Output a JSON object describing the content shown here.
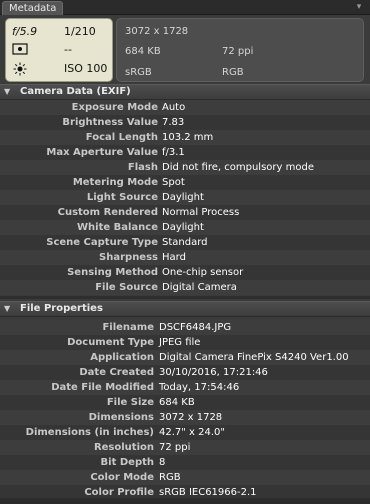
{
  "tab": {
    "label": "Metadata"
  },
  "summary": {
    "aperture": "f/5.9",
    "shutter": "1/210",
    "exposure_comp": "--",
    "iso": "ISO 100",
    "dimensions": "3072 x 1728",
    "size": "684 KB",
    "resolution": "72 ppi",
    "profile": "sRGB",
    "color_mode": "RGB"
  },
  "exif": {
    "title": "Camera Data (EXIF)",
    "rows": [
      {
        "label": "Exposure Mode",
        "value": "Auto"
      },
      {
        "label": "Brightness Value",
        "value": "7.83"
      },
      {
        "label": "Focal Length",
        "value": "103.2 mm"
      },
      {
        "label": "Max Aperture Value",
        "value": "f/3.1"
      },
      {
        "label": "Flash",
        "value": "Did not fire, compulsory mode"
      },
      {
        "label": "Metering Mode",
        "value": "Spot"
      },
      {
        "label": "Light Source",
        "value": "Daylight"
      },
      {
        "label": "Custom Rendered",
        "value": "Normal Process"
      },
      {
        "label": "White Balance",
        "value": "Daylight"
      },
      {
        "label": "Scene Capture Type",
        "value": "Standard"
      },
      {
        "label": "Sharpness",
        "value": "Hard"
      },
      {
        "label": "Sensing Method",
        "value": "One-chip sensor"
      },
      {
        "label": "File Source",
        "value": "Digital Camera"
      }
    ]
  },
  "file": {
    "title": "File Properties",
    "rows": [
      {
        "label": "Filename",
        "value": "DSCF6484.JPG"
      },
      {
        "label": "Document Type",
        "value": "JPEG file"
      },
      {
        "label": "Application",
        "value": "Digital Camera FinePix S4240 Ver1.00"
      },
      {
        "label": "Date Created",
        "value": "30/10/2016, 17:21:46"
      },
      {
        "label": "Date File Modified",
        "value": "Today, 17:54:46"
      },
      {
        "label": "File Size",
        "value": "684 KB"
      },
      {
        "label": "Dimensions",
        "value": "3072 x 1728"
      },
      {
        "label": "Dimensions (in inches)",
        "value": "42.7\" x 24.0\""
      },
      {
        "label": "Resolution",
        "value": "72 ppi"
      },
      {
        "label": "Bit Depth",
        "value": "8"
      },
      {
        "label": "Color Mode",
        "value": "RGB"
      },
      {
        "label": "Color Profile",
        "value": "sRGB IEC61966-2.1"
      }
    ]
  }
}
